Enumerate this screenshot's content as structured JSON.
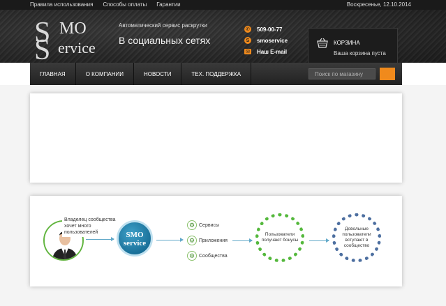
{
  "topbar": {
    "links": [
      "Правила использования",
      "Способы оплаты",
      "Гарантии"
    ],
    "date": "Воскресенье, 12.10.2014"
  },
  "logo": {
    "letter1": "S",
    "part1": "MO",
    "letter2": "S",
    "part2": "ervice"
  },
  "header": {
    "tagline": "Автоматический сервис раскрутки",
    "tagline_big": "В социальных сетях",
    "contacts": [
      {
        "icon": "phone-icon",
        "text": "509-00-77"
      },
      {
        "icon": "skype-icon",
        "text": "smoservice"
      },
      {
        "icon": "mail-icon",
        "text": "Наш E-mail"
      }
    ]
  },
  "cart": {
    "title": "КОРЗИНА",
    "status": "Ваша корзина пуста"
  },
  "nav": {
    "items": [
      "ГЛАВНАЯ",
      "О КОМПАНИИ",
      "НОВОСТИ",
      "ТЕХ. ПОДДЕРЖКА"
    ],
    "search_placeholder": "Поиск по магазину"
  },
  "diagram": {
    "owner_text": "Владелец сообщества хочет много пользователей",
    "smo_line1": "SMO",
    "smo_line2": "service",
    "services": [
      "Сервисы",
      "Приложения",
      "Сообщества"
    ],
    "green_ring_text": "Пользователи получают бонусы",
    "blue_ring_text": "Довольные пользователи вступают в сообщество"
  },
  "colors": {
    "accent": "#f08a1c",
    "green": "#54b83c",
    "blue": "#0a5d86"
  }
}
